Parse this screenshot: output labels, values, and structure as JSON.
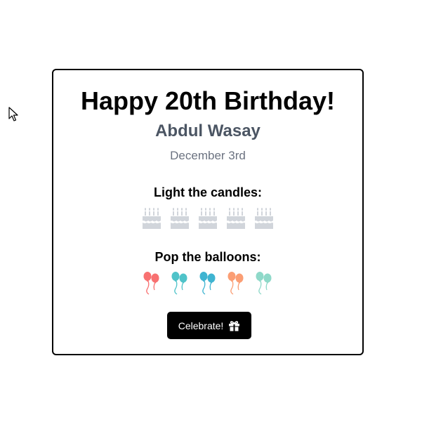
{
  "card": {
    "title": "Happy 20th Birthday!",
    "name": "Abdul Wasay",
    "date": "December 3rd"
  },
  "candles": {
    "heading": "Light the candles:",
    "count": 5,
    "icon": "cake-icon",
    "color": "#d1d5db"
  },
  "balloons": {
    "heading": "Pop the balloons:",
    "icon": "balloons-icon",
    "colors": [
      "#f87171",
      "#4fc3c9",
      "#3fb4d1",
      "#fb9e74",
      "#8fd9c9"
    ]
  },
  "button": {
    "label": "Celebrate!",
    "icon": "gift-icon"
  }
}
